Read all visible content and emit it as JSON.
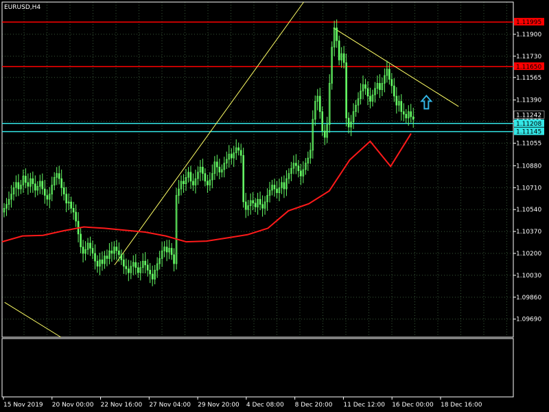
{
  "window": {
    "symbol_timeframe": "EURUSD,H4"
  },
  "colors": {
    "background": "#000000",
    "grid": "#3a5a3a",
    "candle": "#66ff66",
    "moving_average": "#ff1a1a",
    "trendline": "#ffff66",
    "resistance_line": "#ff0000",
    "support_line": "#33e6e6",
    "arrow": "#33b5e5",
    "frame": "#ffffff"
  },
  "icons": {
    "signal_arrow": "up-arrow-icon"
  },
  "chart_data": {
    "type": "candlestick",
    "title": "",
    "y_axis": {
      "ticks": [
        "1.11900",
        "1.11730",
        "1.11565",
        "1.11390",
        "1.11225",
        "1.11055",
        "1.10880",
        "1.10710",
        "1.10540",
        "1.10370",
        "1.10200",
        "1.10030",
        "1.09860",
        "1.09690"
      ],
      "range": [
        1.0955,
        1.1215
      ]
    },
    "x_axis": {
      "ticks": [
        "15 Nov 2019",
        "20 Nov 00:00",
        "22 Nov 16:00",
        "27 Nov 04:00",
        "29 Nov 20:00",
        "4 Dec 08:00",
        "8 Dec 20:00",
        "11 Dec 12:00",
        "16 Dec 00:00",
        "18 Dec 16:00"
      ]
    },
    "price_levels": [
      {
        "name": "resistance-1",
        "value": 1.11995,
        "label": "1.11995",
        "style": "resistance"
      },
      {
        "name": "resistance-2",
        "value": 1.1165,
        "label": "1.11650",
        "style": "resistance"
      },
      {
        "name": "support-1",
        "value": 1.11208,
        "label": "1.11208",
        "style": "support"
      },
      {
        "name": "support-2",
        "value": 1.11145,
        "label": "1.11145",
        "style": "support"
      }
    ],
    "last_price": "1.11242",
    "close_series": [
      1.1055,
      1.1058,
      1.1062,
      1.1066,
      1.1071,
      1.1075,
      1.107,
      1.1073,
      1.108,
      1.1075,
      1.1072,
      1.1078,
      1.1074,
      1.1069,
      1.1072,
      1.1076,
      1.107,
      1.1065,
      1.1062,
      1.1066,
      1.1073,
      1.1079,
      1.1082,
      1.1078,
      1.1071,
      1.1066,
      1.1059,
      1.106,
      1.1055,
      1.1052,
      1.1045,
      1.1035,
      1.1025,
      1.102,
      1.1023,
      1.1028,
      1.1024,
      1.102,
      1.1014,
      1.101,
      1.1015,
      1.1012,
      1.1018,
      1.1016,
      1.1022,
      1.102,
      1.1025,
      1.1022,
      1.1019,
      1.1015,
      1.101,
      1.1008,
      1.1005,
      1.101,
      1.1013,
      1.1009,
      1.1005,
      1.1009,
      1.1014,
      1.1011,
      1.1007,
      1.1004,
      1.1,
      1.1007,
      1.1012,
      1.1016,
      1.1022,
      1.1025,
      1.1021,
      1.1024,
      1.1019,
      1.1012,
      1.1065,
      1.107,
      1.1076,
      1.1074,
      1.1079,
      1.1083,
      1.1076,
      1.1073,
      1.1078,
      1.1083,
      1.1087,
      1.1082,
      1.1076,
      1.1073,
      1.1077,
      1.1082,
      1.1091,
      1.1087,
      1.1083,
      1.1085,
      1.109,
      1.1093,
      1.1097,
      1.1094,
      1.1098,
      1.1102,
      1.11,
      1.1096,
      1.106,
      1.1054,
      1.1057,
      1.1061,
      1.1059,
      1.1056,
      1.1062,
      1.1058,
      1.1055,
      1.106,
      1.1065,
      1.1069,
      1.1073,
      1.107,
      1.1067,
      1.1071,
      1.1075,
      1.107,
      1.1078,
      1.1082,
      1.1086,
      1.109,
      1.1088,
      1.1084,
      1.108,
      1.1085,
      1.109,
      1.1094,
      1.11,
      1.1124,
      1.1138,
      1.1142,
      1.113,
      1.1115,
      1.111,
      1.112,
      1.1152,
      1.118,
      1.1195,
      1.1185,
      1.117,
      1.1175,
      1.1168,
      1.1125,
      1.1118,
      1.1122,
      1.113,
      1.1135,
      1.114,
      1.1146,
      1.1151,
      1.1148,
      1.1142,
      1.1138,
      1.1143,
      1.1148,
      1.1152,
      1.1147,
      1.1152,
      1.1158,
      1.1163,
      1.1155,
      1.115,
      1.1142,
      1.1135,
      1.1138,
      1.113,
      1.1128,
      1.1125,
      1.113,
      1.1126,
      1.1124
    ],
    "moving_average": {
      "x_frac": [
        0,
        0.04,
        0.08,
        0.12,
        0.16,
        0.2,
        0.24,
        0.28,
        0.32,
        0.36,
        0.4,
        0.44,
        0.48,
        0.52,
        0.56,
        0.6,
        0.64,
        0.68,
        0.72,
        0.76,
        0.8
      ],
      "values": [
        1.1029,
        1.10335,
        1.1034,
        1.10375,
        1.10405,
        1.10395,
        1.1038,
        1.10365,
        1.10335,
        1.1029,
        1.10295,
        1.1032,
        1.10345,
        1.10395,
        1.1053,
        1.10585,
        1.10685,
        1.10925,
        1.1107,
        1.10875,
        1.1113
      ]
    },
    "trendlines": [
      {
        "name": "rising-trendline",
        "from": {
          "x_frac": 0.22,
          "y": 1.1011
        },
        "to": {
          "x_frac": 0.59,
          "y": 1.1215
        }
      },
      {
        "name": "descending-trendline",
        "from": {
          "x_frac": 0.648,
          "y": 1.1195
        },
        "to": {
          "x_frac": 0.893,
          "y": 1.1134
        }
      },
      {
        "name": "lower-trendline",
        "from": {
          "x_frac": 0.005,
          "y": 1.0982
        },
        "to": {
          "x_frac": 0.115,
          "y": 1.0955
        }
      }
    ],
    "signal": {
      "type": "up-arrow",
      "x_frac": 0.83,
      "price": 1.1137
    },
    "grid": true
  }
}
